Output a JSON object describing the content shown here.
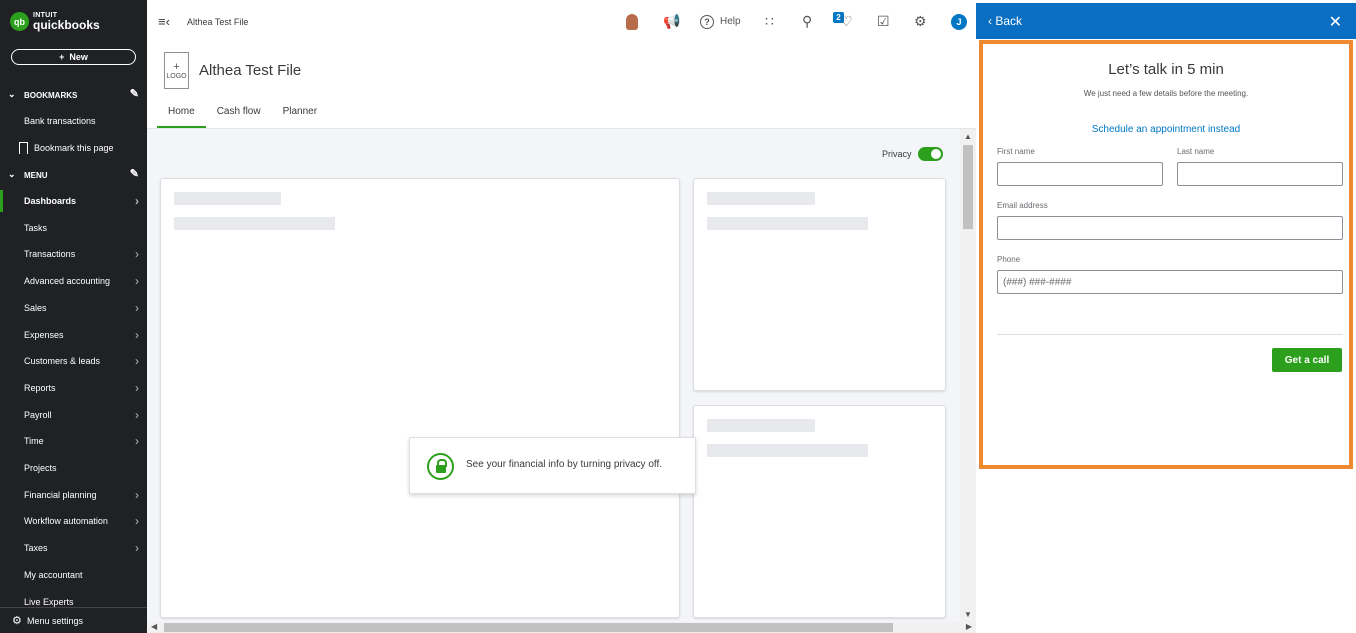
{
  "brand": {
    "top": "INTUIT",
    "bottom": "quickbooks",
    "badge": "qb"
  },
  "sidebar": {
    "new_label": "New",
    "bookmarks_header": "BOOKMARKS",
    "bookmark_links": [
      "Bank transactions",
      "Bookmark this page"
    ],
    "menu_header": "MENU",
    "items": [
      {
        "label": "Dashboards",
        "arrow": true,
        "active": true
      },
      {
        "label": "Tasks",
        "arrow": false
      },
      {
        "label": "Transactions",
        "arrow": true
      },
      {
        "label": "Advanced accounting",
        "arrow": true
      },
      {
        "label": "Sales",
        "arrow": true
      },
      {
        "label": "Expenses",
        "arrow": true
      },
      {
        "label": "Customers & leads",
        "arrow": true
      },
      {
        "label": "Reports",
        "arrow": true
      },
      {
        "label": "Payroll",
        "arrow": true
      },
      {
        "label": "Time",
        "arrow": true
      },
      {
        "label": "Projects",
        "arrow": false
      },
      {
        "label": "Financial planning",
        "arrow": true
      },
      {
        "label": "Workflow automation",
        "arrow": true
      },
      {
        "label": "Taxes",
        "arrow": true
      },
      {
        "label": "My accountant",
        "arrow": false
      },
      {
        "label": "Live Experts",
        "arrow": false
      }
    ],
    "menu_settings": "Menu settings"
  },
  "topbar": {
    "company_small": "Althea Test File",
    "help_label": "Help",
    "notification_count": "2",
    "user_initial": "J"
  },
  "header": {
    "logo_plus": "+",
    "logo_text": "LOGO",
    "company_title": "Althea Test File",
    "tabs": [
      "Home",
      "Cash flow",
      "Planner"
    ]
  },
  "dashboard": {
    "privacy_label": "Privacy",
    "privacy_message": "See your financial info by turning privacy off."
  },
  "panel": {
    "back_label": "Back",
    "title": "Let’s talk in 5 min",
    "subtitle": "We just need a few details before the meeting.",
    "schedule_link": "Schedule an appointment instead",
    "first_name_label": "First name",
    "last_name_label": "Last name",
    "email_label": "Email address",
    "phone_label": "Phone",
    "phone_placeholder": "(###) ###-####",
    "submit_label": "Get a call"
  },
  "colors": {
    "accent_green": "#2ca01c",
    "header_blue": "#0a6fc2",
    "highlight_orange": "#f08a30",
    "sidebar_bg": "#1f2124"
  }
}
